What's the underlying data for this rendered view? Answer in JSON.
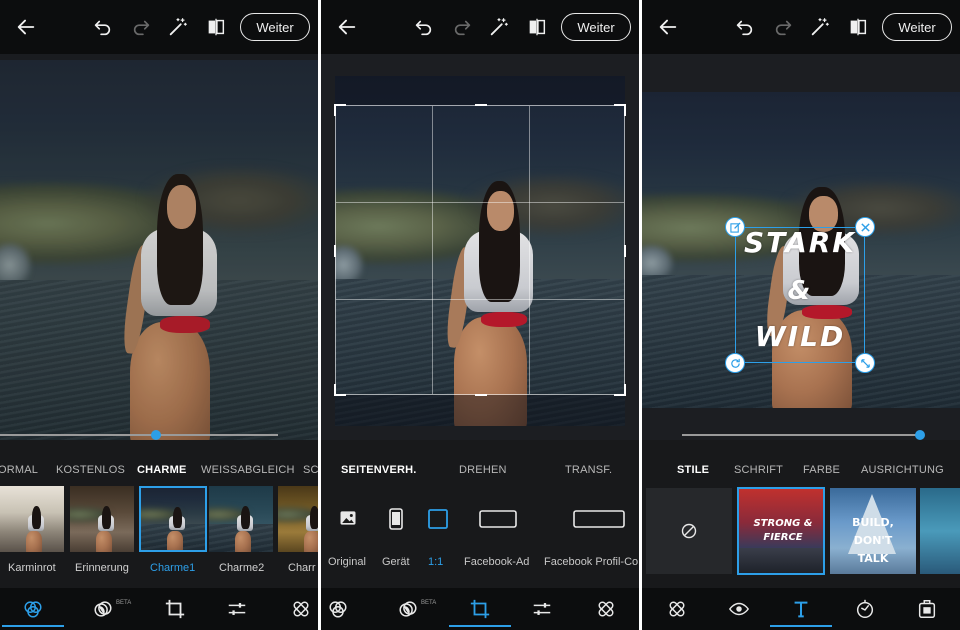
{
  "colors": {
    "accent": "#2d9fe8",
    "topbar_bg": "#0c0d0e",
    "panel_bg": "#18191b"
  },
  "common": {
    "weiter_label": "Weiter",
    "beta_label": "BETA"
  },
  "panel1": {
    "tabs": [
      "ORMAL",
      "KOSTENLOS",
      "CHARME",
      "WEISSABGLEICH",
      "SC"
    ],
    "active_tab": "CHARME",
    "slider_value": 0.56,
    "filters": [
      {
        "label": "Karminrot"
      },
      {
        "label": "Erinnerung"
      },
      {
        "label": "Charme1"
      },
      {
        "label": "Charme2"
      },
      {
        "label": "Charr"
      }
    ],
    "selected_filter": "Charme1",
    "bottom_icons": [
      "looks-icon",
      "healing-icon",
      "crop-icon",
      "adjust-icon",
      "bandage-icon"
    ]
  },
  "panel2": {
    "tabs": [
      "SEITENVERH.",
      "DREHEN",
      "TRANSF."
    ],
    "active_tab": "SEITENVERH.",
    "ratios": [
      {
        "label": "Original",
        "icon": "image-icon"
      },
      {
        "label": "Gerät",
        "icon": "device-icon"
      },
      {
        "label": "1:1",
        "icon": "square-icon"
      },
      {
        "label": "Facebook-Ad",
        "icon": "rect-icon"
      },
      {
        "label": "Facebook Profil-Co",
        "icon": "wide-rect-icon"
      }
    ],
    "selected_ratio": "1:1"
  },
  "panel3": {
    "tabs": [
      "STILE",
      "SCHRIFT",
      "FARBE",
      "AUSRICHTUNG"
    ],
    "active_tab": "STILE",
    "slider_value": 1.0,
    "overlay_lines": [
      "STARK",
      "&",
      "WILD"
    ],
    "styles": [
      {
        "text": ""
      },
      {
        "text": "STRONG & FIERCE"
      },
      {
        "text": "BUILD, DON'T TALK"
      },
      {
        "text": ""
      }
    ]
  }
}
